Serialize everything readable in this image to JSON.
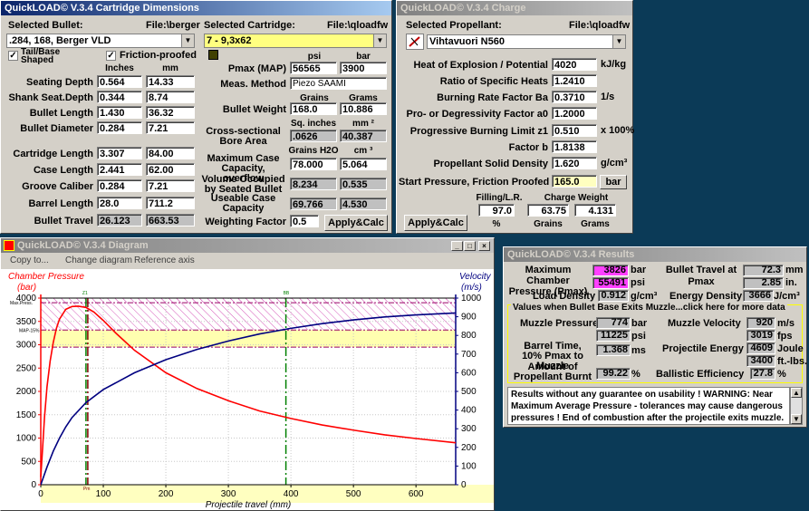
{
  "cartridge_window": {
    "title": "QuickLOAD© V.3.4 Cartridge Dimensions",
    "selected_bullet_label": "Selected Bullet:",
    "bullet_file": "File:\\berger",
    "bullet_value": ".284, 168, Berger VLD",
    "tail_base_label": "Tail/Base Shaped",
    "friction_label": "Friction-proofed",
    "selected_cartridge_label": "Selected Cartridge:",
    "cartridge_file": "File:\\qloadfw",
    "cartridge_value": "7 - 9,3x62",
    "col_inches": "Inches",
    "col_mm": "mm",
    "rows": [
      {
        "label": "Seating Depth",
        "in": "0.564",
        "mm": "14.33"
      },
      {
        "label": "Shank Seat.Depth",
        "in": "0.344",
        "mm": "8.74"
      },
      {
        "label": "Bullet Length",
        "in": "1.430",
        "mm": "36.32"
      },
      {
        "label": "Bullet Diameter",
        "in": "0.284",
        "mm": "7.21"
      },
      {
        "label": "Cartridge Length",
        "in": "3.307",
        "mm": "84.00"
      },
      {
        "label": "Case Length",
        "in": "2.441",
        "mm": "62.00"
      },
      {
        "label": "Groove Caliber",
        "in": "0.284",
        "mm": "7.21"
      },
      {
        "label": "Barrel Length",
        "in": "28.0",
        "mm": "711.2"
      },
      {
        "label": "Bullet Travel",
        "in": "26.123",
        "mm": "663.53"
      }
    ],
    "col_psi": "psi",
    "col_bar": "bar",
    "pmax_label": "Pmax (MAP)",
    "pmax_psi": "56565",
    "pmax_bar": "3900",
    "meas_label": "Meas. Method",
    "meas_value": "Piezo SAAMI",
    "col_grains": "Grains",
    "col_grams": "Grams",
    "bw_label": "Bullet Weight",
    "bw_grains": "168.0",
    "bw_grams": "10.886",
    "col_sqin": "Sq. inches",
    "col_mm2": "mm ²",
    "bore_label": "Cross-sectional Bore Area",
    "bore_sqin": ".0626",
    "bore_mm2": "40.387",
    "col_grh2o": "Grains H2O",
    "col_cm3": "cm ³",
    "maxcase_label": "Maximum Case Capacity, overflow",
    "maxcase_gr": "78.000",
    "maxcase_cm3": "5.064",
    "volocc_label": "Volume Occupied by Seated Bullet",
    "volocc_gr": "8.234",
    "volocc_cm3": "0.535",
    "usable_label": "Useable Case Capacity",
    "usable_gr": "69.766",
    "usable_cm3": "4.530",
    "wf_label": "Weighting Factor",
    "wf_value": "0.5",
    "apply_label": "Apply&Calc"
  },
  "charge_window": {
    "title": "QuickLOAD© V.3.4 Charge",
    "selected_label": "Selected Propellant:",
    "file": "File:\\qloadfw",
    "propellant": "Vihtavuori N560",
    "rows": [
      {
        "label": "Heat of Explosion / Potential",
        "value": "4020",
        "unit": "kJ/kg"
      },
      {
        "label": "Ratio of Specific Heats",
        "value": "1.2410",
        "unit": ""
      },
      {
        "label": "Burning Rate Factor  Ba",
        "value": "0.3710",
        "unit": "1/s"
      },
      {
        "label": "Pro- or Degressivity Factor  a0",
        "value": "1.2000",
        "unit": ""
      },
      {
        "label": "Progressive Burning Limit z1",
        "value": "0.510",
        "unit": "x 100%"
      },
      {
        "label": "Factor  b",
        "value": "1.8138",
        "unit": ""
      },
      {
        "label": "Propellant Solid Density",
        "value": "1.620",
        "unit": "g/cm³"
      }
    ],
    "start_label": "Start Pressure, Friction Proofed",
    "start_value": "165.0",
    "start_unit": "bar",
    "filling_label": "Filling/L.R.",
    "filling_value": "97.0",
    "filling_unit": "%",
    "cw_label": "Charge Weight",
    "cw_grains": "63.75",
    "cw_grams": "4.131",
    "unit_grains": "Grains",
    "unit_grams": "Grams",
    "apply_label": "Apply&Calc"
  },
  "diagram_window": {
    "title": "QuickLOAD© V.3.4 Diagram",
    "menu": [
      "Copy to...",
      "Change diagram",
      "Reference axis"
    ],
    "left_title": "Chamber Pressure",
    "left_unit": "(bar)",
    "right_title": "Velocity",
    "right_unit": "(m/s)",
    "max_press_label": "Max.Press.",
    "map_label": "MAP-15%",
    "z1_label": "Z1",
    "bb_label": "BB",
    "pm_label": "Pm",
    "xlabel": "Projectile travel (mm)"
  },
  "chart_data": {
    "type": "line",
    "xlabel": "Projectile travel (mm)",
    "ylabel": "Chamber Pressure (bar)",
    "y2label": "Velocity (m/s)",
    "xlim": [
      0,
      663.5
    ],
    "ylim": [
      0,
      4000
    ],
    "y2lim": [
      0,
      1000
    ],
    "x_ticks": [
      0,
      100,
      200,
      300,
      400,
      500,
      600
    ],
    "y_ticks": [
      0,
      500,
      1000,
      1500,
      2000,
      2500,
      3000,
      3500,
      4000
    ],
    "y2_ticks": [
      0,
      100,
      200,
      300,
      400,
      500,
      600,
      700,
      800,
      900,
      1000
    ],
    "grid": true,
    "colors": {
      "pressure": "#ff0000",
      "velocity": "#000080"
    },
    "pressure": {
      "x": [
        0,
        3,
        6,
        10,
        15,
        20,
        25,
        30,
        40,
        50,
        60,
        72.3,
        85,
        100,
        120,
        150,
        200,
        250,
        300,
        350,
        400,
        450,
        500,
        550,
        600,
        663.5
      ],
      "y": [
        165,
        800,
        1450,
        2100,
        2650,
        3050,
        3350,
        3550,
        3760,
        3820,
        3826,
        3800,
        3700,
        3520,
        3250,
        2880,
        2400,
        2060,
        1800,
        1580,
        1420,
        1280,
        1170,
        1070,
        990,
        900
      ]
    },
    "velocity": {
      "x": [
        0,
        10,
        20,
        30,
        40,
        50,
        72.3,
        100,
        150,
        200,
        250,
        300,
        350,
        400,
        450,
        500,
        550,
        600,
        663.5
      ],
      "y": [
        0,
        95,
        180,
        250,
        310,
        360,
        440,
        510,
        600,
        670,
        725,
        770,
        808,
        838,
        863,
        883,
        899,
        910,
        920
      ]
    },
    "max_press_line": 3900,
    "map15_line": 3315,
    "lower_band": [
      2950,
      3315
    ],
    "z1_x": 72.3,
    "bb_x": 392,
    "pm_x": 72.3
  },
  "results_window": {
    "title": "QuickLOAD© V.3.4 Results",
    "max_chamber_label": "Maximum Chamber Pressure (Pmax)",
    "max_chamber_bar": "3826",
    "max_chamber_bar_unit": "bar",
    "max_chamber_psi": "55491",
    "max_chamber_psi_unit": "psi",
    "travel_label": "Bullet Travel at Pmax",
    "travel_mm": "72.3",
    "travel_mm_unit": "mm",
    "travel_in": "2.85",
    "travel_in_unit": "in.",
    "load_density_label": "Load Density",
    "load_density_value": "0.912",
    "load_density_unit": "g/cm³",
    "energy_density_label": "Energy Density",
    "energy_density_value": "3666",
    "energy_density_unit": "J/cm³",
    "section_title": "Values when Bullet Base Exits Muzzle...click here for more data",
    "muzzle_pressure_label": "Muzzle Pressure",
    "muzzle_pressure_bar": "774",
    "muzzle_pressure_bar_unit": "bar",
    "muzzle_pressure_psi": "11225",
    "muzzle_pressure_psi_unit": "psi",
    "muzzle_velocity_label": "Muzzle Velocity",
    "muzzle_velocity_ms": "920",
    "muzzle_velocity_ms_unit": "m/s",
    "muzzle_velocity_fps": "3019",
    "muzzle_velocity_fps_unit": "fps",
    "barrel_time_label": "Barrel Time, 10% Pmax to Muzzle",
    "barrel_time_value": "1.368",
    "barrel_time_unit": "ms",
    "energy_label": "Projectile Energy",
    "energy_joule": "4609",
    "energy_joule_unit": "Joule",
    "energy_ftlbs": "3400",
    "energy_ftlbs_unit": "ft.-lbs.",
    "burnt_label": "Amount of Propellant Burnt",
    "burnt_value": "99.22",
    "burnt_unit": "%",
    "ballistic_label": "Ballistic Efficiency",
    "ballistic_value": "27.8",
    "ballistic_unit": "%",
    "warning_text": "Results without any guarantee on usability !  WARNING: Near Maximum Average Pressure - tolerances may cause dangerous pressures !  End of combustion after the projectile exits muzzle."
  }
}
